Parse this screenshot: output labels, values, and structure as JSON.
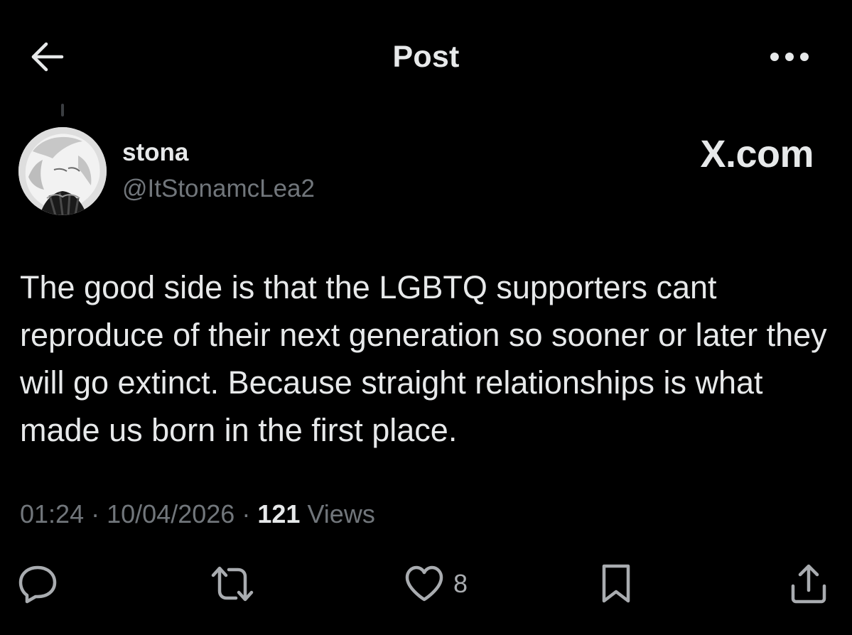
{
  "header": {
    "title": "Post",
    "back_icon": "arrow-left-icon",
    "more_icon": "more-horizontal-icon"
  },
  "post": {
    "author_name": "stona",
    "author_handle": "@ItStonamcLea2",
    "watermark": "X.com",
    "text": "The good side is that the LGBTQ supporters cant reproduce of their next generation so sooner or later they will go extinct. Because straight relationships is what made us born in the first place.",
    "time": "01:24",
    "date": "10/04/2026",
    "separator": "·",
    "views_count": "121",
    "views_label": "Views"
  },
  "actions": {
    "reply_icon": "reply-icon",
    "repost_icon": "repost-icon",
    "like_icon": "heart-icon",
    "like_count": "8",
    "bookmark_icon": "bookmark-icon",
    "share_icon": "share-icon"
  },
  "colors": {
    "background": "#000000",
    "text_primary": "#e7e9ea",
    "text_secondary": "#71767b",
    "icon": "#a9acb0"
  }
}
